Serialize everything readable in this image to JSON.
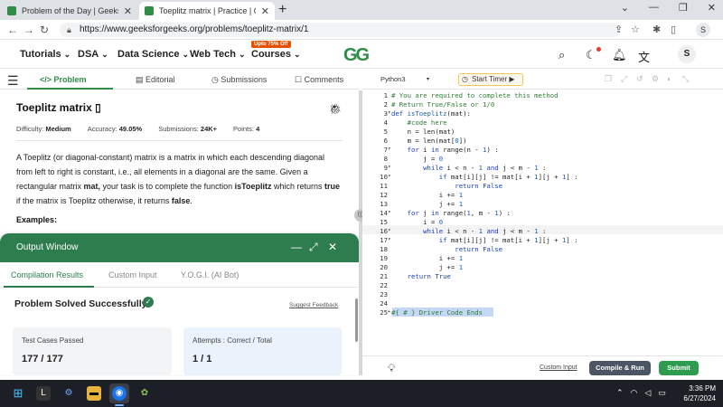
{
  "browser": {
    "tabs": [
      {
        "label": "Problem of the Day | GeeksforGe",
        "close": "✕"
      },
      {
        "label": "Toeplitz matrix | Practice | Geeks",
        "close": "✕"
      }
    ],
    "new_tab": "+",
    "window_controls": [
      "⌄",
      "—",
      "❐",
      "✕"
    ],
    "url": "https://www.geeksforgeeks.org/problems/toeplitz-matrix/1",
    "profile_initial": "S"
  },
  "site_nav": {
    "items": [
      "Tutorials",
      "DSA",
      "Data Science",
      "Web Tech",
      "Courses"
    ],
    "promo_badge": "Upto 75% Off",
    "logo": "GG",
    "avatar_initial": "S"
  },
  "problem_tabs": [
    "Problem",
    "Editorial",
    "Submissions",
    "Comments"
  ],
  "problem": {
    "title": "Toeplitz matrix",
    "difficulty_label": "Difficulty:",
    "difficulty": "Medium",
    "accuracy_label": "Accuracy:",
    "accuracy": "49.05%",
    "submissions_label": "Submissions:",
    "submissions": "24K+",
    "points_label": "Points:",
    "points": "4",
    "desc_1": "A Toeplitz (or diagonal-constant) matrix is a matrix in which each descending diagonal from left to right is constant, i.e., all elements in a diagonal are the same. Given a rectangular matrix ",
    "desc_mat": "mat,",
    "desc_2": " your task is to complete the function ",
    "desc_fn": "isToeplitz",
    "desc_3": " which returns ",
    "desc_true": "true",
    "desc_4": " if the matrix is Toeplitz otherwise, it returns ",
    "desc_false": "false",
    "desc_5": ".",
    "examples": "Examples:"
  },
  "output_window": {
    "title": "Output Window",
    "tabs": [
      "Compilation Results",
      "Custom Input",
      "Y.O.G.I. (AI Bot)"
    ],
    "status": "Problem Solved Successfully",
    "suggest": "Suggest Feedback",
    "test_cases_label": "Test Cases Passed",
    "test_cases_value": "177 / 177",
    "attempts_label": "Attempts : Correct / Total",
    "attempts_value": "1 / 1"
  },
  "editor_toolbar": {
    "language": "Python3",
    "timer": "Start Timer"
  },
  "code_lines": [
    {
      "n": "1",
      "fold": "",
      "html": "<span class=\"cm\"># You are required to complete this method</span>"
    },
    {
      "n": "2",
      "fold": "",
      "html": "<span class=\"cm\"># Return True/False or 1/0</span>"
    },
    {
      "n": "3",
      "fold": "▾",
      "html": "<span class=\"kw\">def</span> <span class=\"fn\">isToeplitz</span>(mat):"
    },
    {
      "n": "4",
      "fold": "",
      "html": "    <span class=\"cm\">#code here</span>"
    },
    {
      "n": "5",
      "fold": "",
      "html": "    n = len(mat)"
    },
    {
      "n": "6",
      "fold": "",
      "html": "    m = len(mat[<span class=\"nm\">0</span>])"
    },
    {
      "n": "7",
      "fold": "▾",
      "html": "    <span class=\"kw\">for</span> i <span class=\"kw\">in</span> range(n - <span class=\"nm\">1</span>) :"
    },
    {
      "n": "8",
      "fold": "",
      "html": "        j = <span class=\"nm\">0</span>"
    },
    {
      "n": "9",
      "fold": "▾",
      "html": "        <span class=\"kw\">while</span> i &lt; n - <span class=\"nm\">1</span> <span class=\"kw\">and</span> j &lt; m - <span class=\"nm\">1</span> :"
    },
    {
      "n": "10",
      "fold": "▾",
      "html": "            <span class=\"kw\">if</span> mat[i][j] != mat[i + <span class=\"nm\">1</span>][j + <span class=\"nm\">1</span>] :"
    },
    {
      "n": "11",
      "fold": "",
      "html": "                <span class=\"kw\">return</span> <span class=\"kw\">False</span>"
    },
    {
      "n": "12",
      "fold": "",
      "html": "            i += <span class=\"nm\">1</span>"
    },
    {
      "n": "13",
      "fold": "",
      "html": "            j += <span class=\"nm\">1</span>"
    },
    {
      "n": "14",
      "fold": "▾",
      "html": "    <span class=\"kw\">for</span> j <span class=\"kw\">in</span> range(<span class=\"nm\">1</span>, m - <span class=\"nm\">1</span>) :"
    },
    {
      "n": "15",
      "fold": "",
      "html": "        i = <span class=\"nm\">0</span>"
    },
    {
      "n": "16",
      "fold": "▾",
      "html": "        <span class=\"kw\">while</span> i &lt; n - <span class=\"nm\">1</span> <span class=\"kw\">and</span> j &lt; m - <span class=\"nm\">1</span> :"
    },
    {
      "n": "17",
      "fold": "▾",
      "html": "            <span class=\"kw\">if</span> mat[i][j] != mat[i + <span class=\"nm\">1</span>][j + <span class=\"nm\">1</span>] :"
    },
    {
      "n": "18",
      "fold": "",
      "html": "                <span class=\"kw\">return</span> <span class=\"kw\">False</span>"
    },
    {
      "n": "19",
      "fold": "",
      "html": "            i += <span class=\"nm\">1</span>"
    },
    {
      "n": "20",
      "fold": "",
      "html": "            j += <span class=\"nm\">1</span>"
    },
    {
      "n": "21",
      "fold": "",
      "html": "    <span class=\"kw\">return</span> <span class=\"kw\">True</span>"
    },
    {
      "n": "22",
      "fold": "",
      "html": ""
    },
    {
      "n": "23",
      "fold": "",
      "html": ""
    },
    {
      "n": "24",
      "fold": "",
      "html": ""
    },
    {
      "n": "25",
      "fold": "▸",
      "html": "<span class=\"cm\">#{ </span><span class=\"cm\"># } Driver Code Ends</span>"
    }
  ],
  "editor_footer": {
    "custom_input": "Custom Input",
    "compile": "Compile & Run",
    "submit": "Submit"
  },
  "taskbar": {
    "time": "3:36 PM",
    "date": "6/27/2024"
  }
}
